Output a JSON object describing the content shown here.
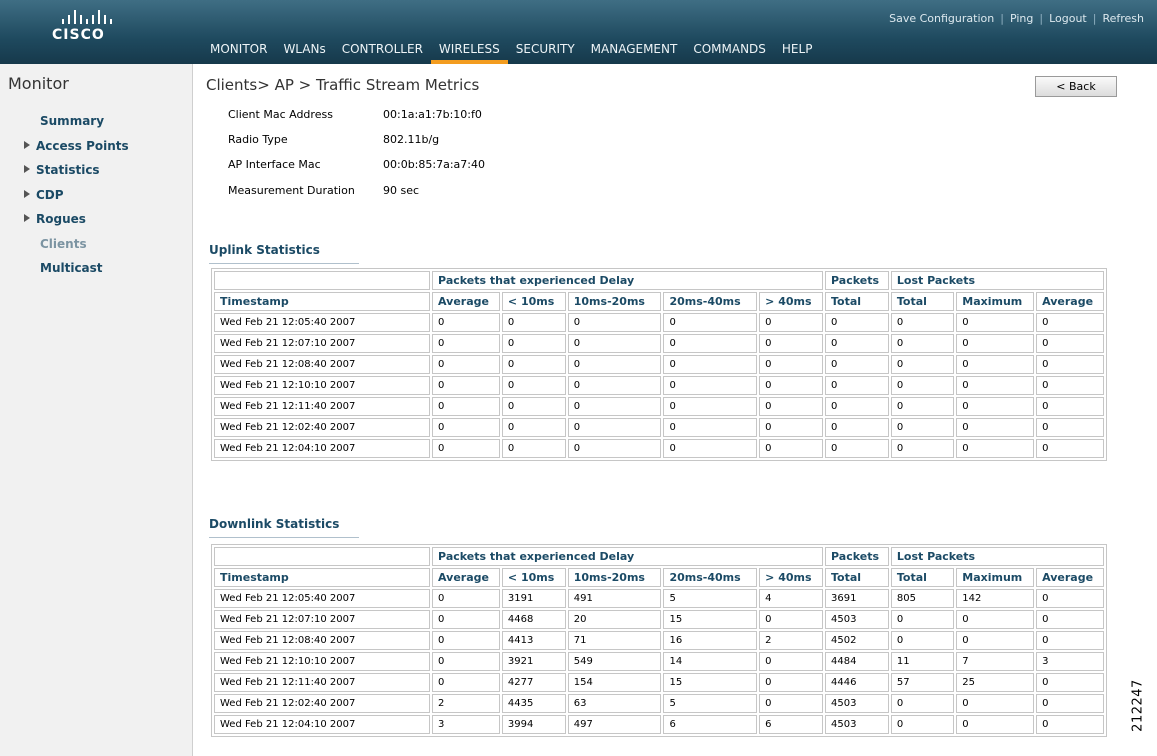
{
  "header": {
    "logo_text": "CISCO",
    "top_links": [
      "Save Configuration",
      "Ping",
      "Logout",
      "Refresh"
    ],
    "nav": [
      "MONITOR",
      "WLANs",
      "CONTROLLER",
      "WIRELESS",
      "SECURITY",
      "MANAGEMENT",
      "COMMANDS",
      "HELP"
    ],
    "active_nav": "WIRELESS",
    "accent_color": "#f39c1f"
  },
  "sidebar": {
    "title": "Monitor",
    "items": [
      {
        "label": "Summary",
        "expandable": false
      },
      {
        "label": "Access Points",
        "expandable": true
      },
      {
        "label": "Statistics",
        "expandable": true
      },
      {
        "label": "CDP",
        "expandable": true
      },
      {
        "label": "Rogues",
        "expandable": true
      },
      {
        "label": "Clients",
        "expandable": false
      },
      {
        "label": "Multicast",
        "expandable": false
      }
    ],
    "current": "Clients"
  },
  "page": {
    "title": "Clients> AP > Traffic Stream Metrics",
    "back_label": "< Back",
    "info": [
      {
        "label": "Client Mac Address",
        "value": "00:1a:a1:7b:10:f0"
      },
      {
        "label": "Radio Type",
        "value": "802.11b/g"
      },
      {
        "label": "AP Interface Mac",
        "value": "00:0b:85:7a:a7:40"
      },
      {
        "label": "Measurement Duration",
        "value": "90 sec"
      }
    ]
  },
  "table_headers": {
    "group_delay": "Packets that experienced Delay",
    "group_packets": "Packets",
    "group_lost": "Lost Packets",
    "columns": [
      "Timestamp",
      "Average",
      "< 10ms",
      "10ms-20ms",
      "20ms-40ms",
      "> 40ms",
      "Total",
      "Total",
      "Maximum",
      "Average"
    ]
  },
  "uplink": {
    "title": "Uplink Statistics",
    "rows": [
      [
        "Wed Feb 21 12:05:40 2007",
        "0",
        "0",
        "0",
        "0",
        "0",
        "0",
        "0",
        "0",
        "0"
      ],
      [
        "Wed Feb 21 12:07:10 2007",
        "0",
        "0",
        "0",
        "0",
        "0",
        "0",
        "0",
        "0",
        "0"
      ],
      [
        "Wed Feb 21 12:08:40 2007",
        "0",
        "0",
        "0",
        "0",
        "0",
        "0",
        "0",
        "0",
        "0"
      ],
      [
        "Wed Feb 21 12:10:10 2007",
        "0",
        "0",
        "0",
        "0",
        "0",
        "0",
        "0",
        "0",
        "0"
      ],
      [
        "Wed Feb 21 12:11:40 2007",
        "0",
        "0",
        "0",
        "0",
        "0",
        "0",
        "0",
        "0",
        "0"
      ],
      [
        "Wed Feb 21 12:02:40 2007",
        "0",
        "0",
        "0",
        "0",
        "0",
        "0",
        "0",
        "0",
        "0"
      ],
      [
        "Wed Feb 21 12:04:10 2007",
        "0",
        "0",
        "0",
        "0",
        "0",
        "0",
        "0",
        "0",
        "0"
      ]
    ]
  },
  "downlink": {
    "title": "Downlink Statistics",
    "rows": [
      [
        "Wed Feb 21 12:05:40 2007",
        "0",
        "3191",
        "491",
        "5",
        "4",
        "3691",
        "805",
        "142",
        "0"
      ],
      [
        "Wed Feb 21 12:07:10 2007",
        "0",
        "4468",
        "20",
        "15",
        "0",
        "4503",
        "0",
        "0",
        "0"
      ],
      [
        "Wed Feb 21 12:08:40 2007",
        "0",
        "4413",
        "71",
        "16",
        "2",
        "4502",
        "0",
        "0",
        "0"
      ],
      [
        "Wed Feb 21 12:10:10 2007",
        "0",
        "3921",
        "549",
        "14",
        "0",
        "4484",
        "11",
        "7",
        "3"
      ],
      [
        "Wed Feb 21 12:11:40 2007",
        "0",
        "4277",
        "154",
        "15",
        "0",
        "4446",
        "57",
        "25",
        "0"
      ],
      [
        "Wed Feb 21 12:02:40 2007",
        "2",
        "4435",
        "63",
        "5",
        "0",
        "4503",
        "0",
        "0",
        "0"
      ],
      [
        "Wed Feb 21 12:04:10 2007",
        "3",
        "3994",
        "497",
        "6",
        "6",
        "4503",
        "0",
        "0",
        "0"
      ]
    ]
  },
  "figure_id": "212247"
}
